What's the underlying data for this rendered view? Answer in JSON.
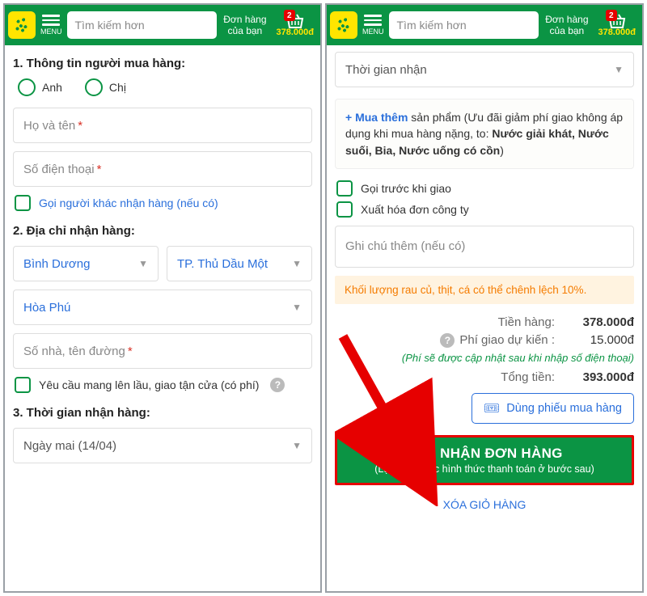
{
  "header": {
    "menu_label": "MENU",
    "search_placeholder": "Tìm kiếm hơn",
    "order_link_l1": "Đơn hàng",
    "order_link_l2": "của bạn",
    "cart_count": "2",
    "cart_total": "378.000đ"
  },
  "s1": {
    "title1": "1. Thông tin người mua hàng:",
    "radio_anh": "Anh",
    "radio_chi": "Chị",
    "fullname_ph": "Họ và tên",
    "phone_ph": "Số điện thoại",
    "other_receiver": "Gọi người khác nhận hàng (nếu có)",
    "title2": "2. Địa chỉ nhận hàng:",
    "province": "Bình Dương",
    "city": "TP. Thủ Dầu Một",
    "ward": "Hòa Phú",
    "street_ph": "Số nhà, tên đường",
    "upstairs": "Yêu cầu mang lên lầu, giao tận cửa (có phí)",
    "title3": "3. Thời gian nhận hàng:",
    "date": "Ngày mai (14/04)"
  },
  "s2": {
    "time_ph": "Thời gian nhận",
    "upsell_plus": "+ Mua thêm",
    "upsell_text1": " sản phẩm (Ưu đãi giảm phí giao không áp dụng khi mua hàng nặng, to: ",
    "upsell_bold": "Nước giải khát, Nước suối, Bia, Nước uống có cồn",
    "upsell_text2": ")",
    "call_before": "Gọi trước khi giao",
    "invoice": "Xuất hóa đơn công ty",
    "note_ph": "Ghi chú thêm (nếu có)",
    "warn": "Khối lượng rau củ, thịt, cá có thể chênh lệch 10%.",
    "row_goods_lbl": "Tiền hàng:",
    "row_goods_val": "378.000đ",
    "row_ship_lbl": "Phí giao dự kiến :",
    "row_ship_val": "15.000đ",
    "ship_note": "(Phí sẽ được cập nhật sau khi nhập số điện thoại)",
    "row_total_lbl": "Tổng tiền:",
    "row_total_val": "393.000đ",
    "voucher": "Dùng phiếu mua hàng",
    "confirm_big": "XÁC NHẬN ĐƠN HÀNG",
    "confirm_sm": "(Lựa chọn các hình thức thanh toán ở bước sau)",
    "clear": "XÓA GIỎ HÀNG"
  }
}
